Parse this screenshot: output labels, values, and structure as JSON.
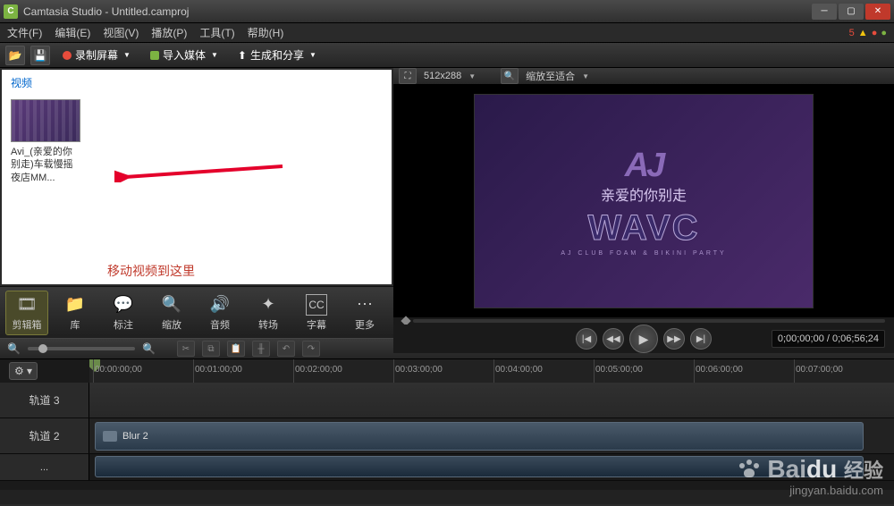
{
  "window": {
    "title": "Camtasia Studio - Untitled.camproj",
    "app_icon_letter": "C"
  },
  "menu": {
    "items": [
      "文件(F)",
      "编辑(E)",
      "视图(V)",
      "播放(P)",
      "工具(T)",
      "帮助(H)"
    ],
    "indicator_count": "5"
  },
  "toolbar": {
    "record": "录制屏幕",
    "import": "导入媒体",
    "produce": "生成和分享"
  },
  "clipbin": {
    "tab": "视频",
    "thumb_name": "Avi_(亲爱的你别走)车载慢摇夜店MM...",
    "hint": "移动视频到这里"
  },
  "tool_tabs": {
    "items": [
      {
        "label": "剪辑箱",
        "icon": "🎞"
      },
      {
        "label": "库",
        "icon": "📁"
      },
      {
        "label": "标注",
        "icon": "💬"
      },
      {
        "label": "缩放",
        "icon": "🔍"
      },
      {
        "label": "音频",
        "icon": "🔊"
      },
      {
        "label": "转场",
        "icon": "✦"
      },
      {
        "label": "字幕",
        "icon": "CC"
      },
      {
        "label": "更多",
        "icon": "⋯"
      }
    ]
  },
  "preview": {
    "dimensions": "512x288",
    "zoom_mode": "缩放至适合",
    "video_subtitle": "亲爱的你别走",
    "video_logo": "AJ",
    "video_brand": "WAVC",
    "video_small": "AJ CLUB FOAM & BIKINI PARTY",
    "time_current": "0;00;00;00",
    "time_total": "0;06;56;24"
  },
  "timeline": {
    "ticks": [
      "00:00:00;00",
      "00:01:00;00",
      "00:02:00;00",
      "00:03:00;00",
      "00:04:00;00",
      "00:05:00;00",
      "00:06:00;00",
      "00:07:00;00"
    ],
    "tracks": [
      {
        "name": "轨道 3"
      },
      {
        "name": "轨道 2",
        "clip": "Blur 2"
      }
    ]
  },
  "watermark": {
    "brand_prefix": "Bai",
    "brand_du": "du",
    "brand_suffix": "经验",
    "url": "jingyan.baidu.com"
  }
}
